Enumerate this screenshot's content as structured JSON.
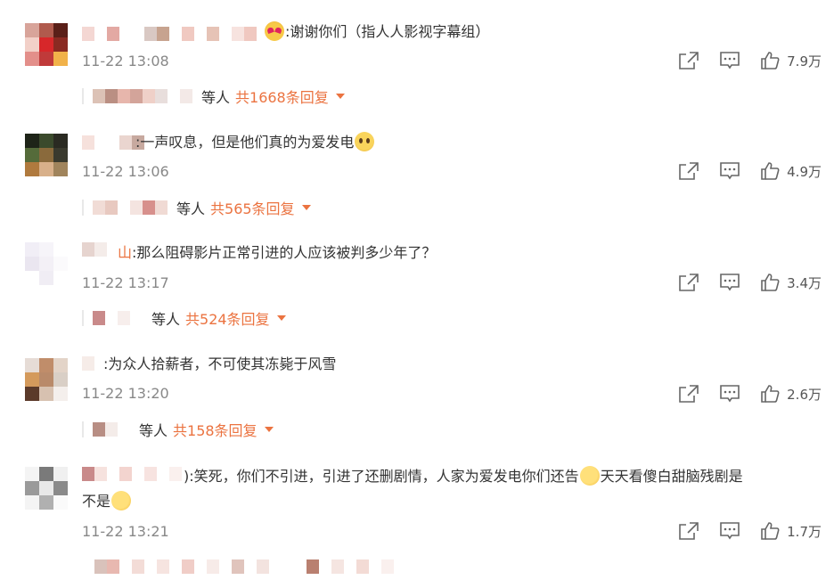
{
  "comments": [
    {
      "text": ":谢谢你们（指人人影视字幕组）",
      "emoji_before": "heart-eyes",
      "time": "11-22 13:08",
      "likes": "7.9万",
      "replies_prefix": "等人",
      "replies_total": "共1668条回复"
    },
    {
      "text": ":一声叹息，但是他们真的为爱发电",
      "emoji_after": "sad",
      "time": "11-22 13:06",
      "likes": "4.9万",
      "replies_prefix": "等人",
      "replies_total": "共565条回复"
    },
    {
      "name_tail": "山",
      "text": ":那么阻碍影片正常引进的人应该被判多少年了？",
      "time": "11-22 13:17",
      "likes": "3.4万",
      "replies_prefix": "等人",
      "replies_total": "共524条回复"
    },
    {
      "text": ":为众人拾薪者，不可使其冻毙于风雪",
      "time": "11-22 13:20",
      "likes": "2.6万",
      "replies_prefix": "等人",
      "replies_total": "共158条回复"
    },
    {
      "text_part1": "):笑死，你们不引进，引进了还删剧情，人家为爱发电你们还告",
      "text_part2": "天天看傻白甜脑残剧是",
      "text_part3": "不是",
      "emoji": "clap",
      "time": "11-22 13:21",
      "likes": "1.7万"
    }
  ],
  "colors": {
    "accent": "#eb7340",
    "time": "#888888",
    "text": "#333333"
  },
  "icons": {
    "share": "share-icon",
    "comment": "comment-icon",
    "like": "thumbs-up-icon"
  }
}
